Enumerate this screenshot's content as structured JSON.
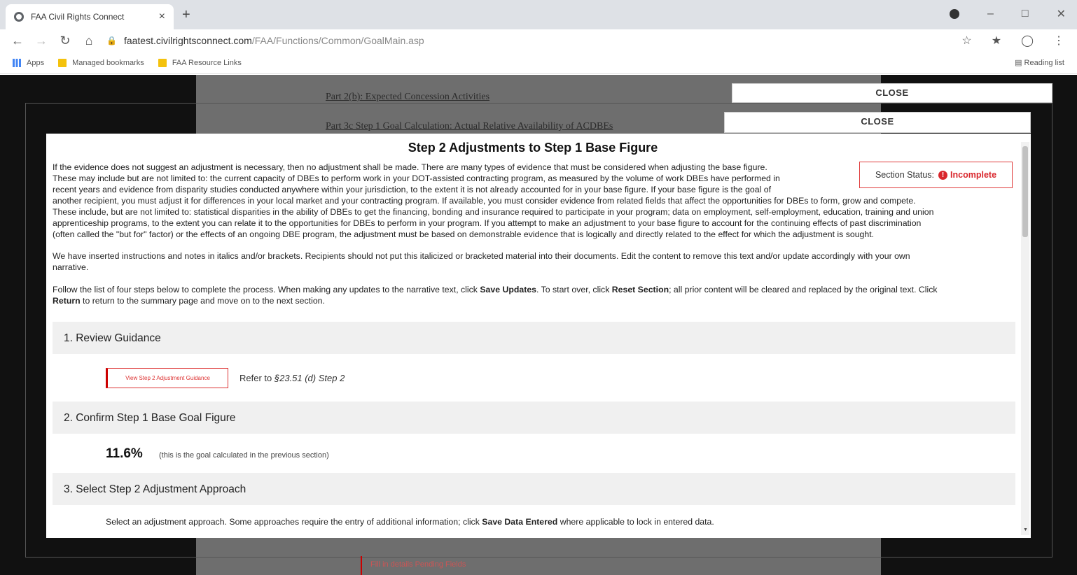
{
  "browser": {
    "tab_title": "FAA Civil Rights Connect",
    "tab_close": "×",
    "new_tab": "+",
    "url_host": "faatest.civilrightsconnect.com",
    "url_path": "/FAA/Functions/Common/GoalMain.asp",
    "bookmarks": [
      "Apps",
      "Managed bookmarks",
      "FAA Resource Links"
    ],
    "reading_list": "Reading list"
  },
  "background": {
    "link1": "Part 2(b): Expected Concession Activities",
    "link2": "Part 3c Step 1 Goal Calculation: Actual Relative Availability of ACDBEs",
    "close1": "CLOSE",
    "close2": "CLOSE",
    "bottom_text": "Fill in details   Pending Fields"
  },
  "modal": {
    "title": "Step 2 Adjustments to Step 1 Base Figure",
    "status_label": "Section Status:",
    "status_value": "Incomplete",
    "para1_lines": [
      "If the evidence does not suggest an adjustment is necessary, then no adjustment shall be made. There are many types of evidence that must be considered when adjusting the base figure.",
      "These may include but are not limited to: the current capacity of DBEs to perform work in your DOT-assisted contracting program, as measured by the volume of work DBEs have performed in",
      "recent years and evidence from disparity studies conducted anywhere within your jurisdiction, to the extent it is not already accounted for in your base figure. If your base figure is the goal of",
      "another recipient, you must adjust it for differences in your local market and your contracting program. If available, you must consider evidence from related fields that affect the opportunities for DBEs to form, grow and compete.",
      "These include, but are not limited to: statistical disparities in the ability of DBEs to get the financing, bonding and insurance required to participate in your program; data on employment, self-employment, education, training and union",
      "apprenticeship programs, to the extent you can relate it to the opportunities for DBEs to perform in your program. If you attempt to make an adjustment to your base figure to account for the continuing effects of past discrimination",
      "(often called the \"but for\" factor) or the effects of an ongoing DBE program, the adjustment must be based on demonstrable evidence that is logically and directly related to the effect for which the adjustment is sought."
    ],
    "para2_lines": [
      "We have inserted instructions and notes in italics and/or brackets. Recipients should not put this italicized or bracketed material into their documents. Edit the content to remove this text and/or update accordingly with your own",
      "narrative."
    ],
    "para3": {
      "a": "Follow the list of four steps below to complete the process. When making any updates to the narrative text, click ",
      "b": "Save Updates",
      "c": ". To start over, click ",
      "d": "Reset Section",
      "e": "; all prior content will be cleared and replaced by the original text. Click",
      "f": "Return",
      "g": " to return to the summary page and move on to the next section."
    },
    "step1_title": "1. Review Guidance",
    "guidance_button": "View Step 2 Adjustment Guidance",
    "refer_text": "Refer to ",
    "refer_ref": "§23.51 (d) Step 2",
    "step2_title": "2. Confirm Step 1 Base Goal Figure",
    "goal_value": "11.6%",
    "goal_note": "(this is the goal calculated in the previous section)",
    "step3_title": "3. Select Step 2 Adjustment Approach",
    "select_text_a": "Select an adjustment approach. Some approaches require the entry of additional information; click ",
    "select_text_b": "Save Data Entered",
    "select_text_c": " where applicable to lock in entered data."
  }
}
